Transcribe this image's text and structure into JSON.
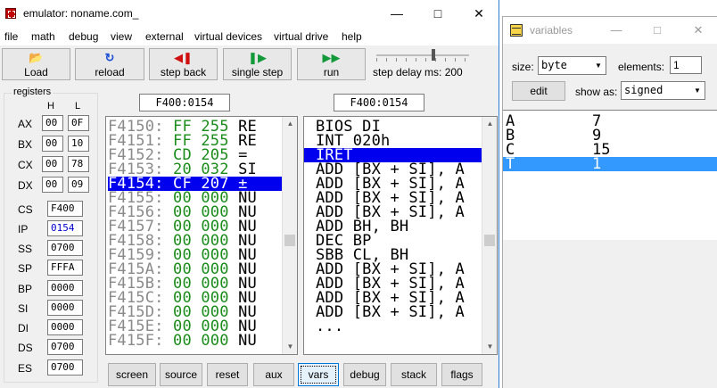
{
  "emulator": {
    "title": "emulator: noname.com_",
    "menu": [
      "file",
      "math",
      "debug",
      "view",
      "external",
      "virtual devices",
      "virtual drive",
      "help"
    ],
    "toolbar": {
      "load": "Load",
      "reload": "reload",
      "step_back": "step back",
      "single_step": "single step",
      "run": "run",
      "step_delay": "step delay ms: 200"
    },
    "registers": {
      "title": "registers",
      "h_label": "H",
      "l_label": "L",
      "ax": {
        "name": "AX",
        "h": "00",
        "l": "0F"
      },
      "bx": {
        "name": "BX",
        "h": "00",
        "l": "10"
      },
      "cx": {
        "name": "CX",
        "h": "00",
        "l": "78"
      },
      "dx": {
        "name": "DX",
        "h": "00",
        "l": "09"
      },
      "cs": {
        "name": "CS",
        "value": "F400"
      },
      "ip": {
        "name": "IP",
        "value": "0154"
      },
      "ss": {
        "name": "SS",
        "value": "0700"
      },
      "sp": {
        "name": "SP",
        "value": "FFFA"
      },
      "bp": {
        "name": "BP",
        "value": "0000"
      },
      "si": {
        "name": "SI",
        "value": "0000"
      },
      "di": {
        "name": "DI",
        "value": "0000"
      },
      "ds": {
        "name": "DS",
        "value": "0700"
      },
      "es": {
        "name": "ES",
        "value": "0700"
      }
    },
    "memory_address": "F400:0154",
    "disasm_address": "F400:0154",
    "memory": [
      {
        "addr": "F4150:",
        "hex": "FF",
        "dec": "255",
        "chr": "RE"
      },
      {
        "addr": "F4151:",
        "hex": "FF",
        "dec": "255",
        "chr": "RE"
      },
      {
        "addr": "F4152:",
        "hex": "CD",
        "dec": "205",
        "chr": "="
      },
      {
        "addr": "F4153:",
        "hex": "20",
        "dec": "032",
        "chr": "SI"
      },
      {
        "addr": "F4154:",
        "hex": "CF",
        "dec": "207",
        "chr": "±"
      },
      {
        "addr": "F4155:",
        "hex": "00",
        "dec": "000",
        "chr": "NU"
      },
      {
        "addr": "F4156:",
        "hex": "00",
        "dec": "000",
        "chr": "NU"
      },
      {
        "addr": "F4157:",
        "hex": "00",
        "dec": "000",
        "chr": "NU"
      },
      {
        "addr": "F4158:",
        "hex": "00",
        "dec": "000",
        "chr": "NU"
      },
      {
        "addr": "F4159:",
        "hex": "00",
        "dec": "000",
        "chr": "NU"
      },
      {
        "addr": "F415A:",
        "hex": "00",
        "dec": "000",
        "chr": "NU"
      },
      {
        "addr": "F415B:",
        "hex": "00",
        "dec": "000",
        "chr": "NU"
      },
      {
        "addr": "F415C:",
        "hex": "00",
        "dec": "000",
        "chr": "NU"
      },
      {
        "addr": "F415D:",
        "hex": "00",
        "dec": "000",
        "chr": "NU"
      },
      {
        "addr": "F415E:",
        "hex": "00",
        "dec": "000",
        "chr": "NU"
      },
      {
        "addr": "F415F:",
        "hex": "00",
        "dec": "000",
        "chr": "NU"
      }
    ],
    "disassembly": [
      "BIOS DI",
      "INT 020h",
      "IRET",
      "ADD [BX + SI], A",
      "ADD [BX + SI], A",
      "ADD [BX + SI], A",
      "ADD [BX + SI], A",
      "ADD BH, BH",
      "DEC BP",
      "SBB CL, BH",
      "ADD [BX + SI], A",
      "ADD [BX + SI], A",
      "ADD [BX + SI], A",
      "ADD [BX + SI], A",
      "..."
    ],
    "bottom_buttons": [
      "screen",
      "source",
      "reset",
      "aux",
      "vars",
      "debug",
      "stack",
      "flags"
    ]
  },
  "variables": {
    "title": "variables",
    "size_label": "size:",
    "size_value": "byte",
    "elements_label": "elements:",
    "elements_value": "1",
    "edit_label": "edit",
    "show_as_label": "show as:",
    "show_as_value": "signed",
    "rows": [
      {
        "name": "A",
        "value": "7"
      },
      {
        "name": "B",
        "value": "9"
      },
      {
        "name": "C",
        "value": "15"
      },
      {
        "name": "T",
        "value": "1"
      }
    ]
  },
  "colors": {
    "selection_blue": "#0000ee",
    "vars_selection": "#3399ff",
    "hex_green": "#1a8c1a",
    "addr_gray": "#8a8a8a"
  }
}
